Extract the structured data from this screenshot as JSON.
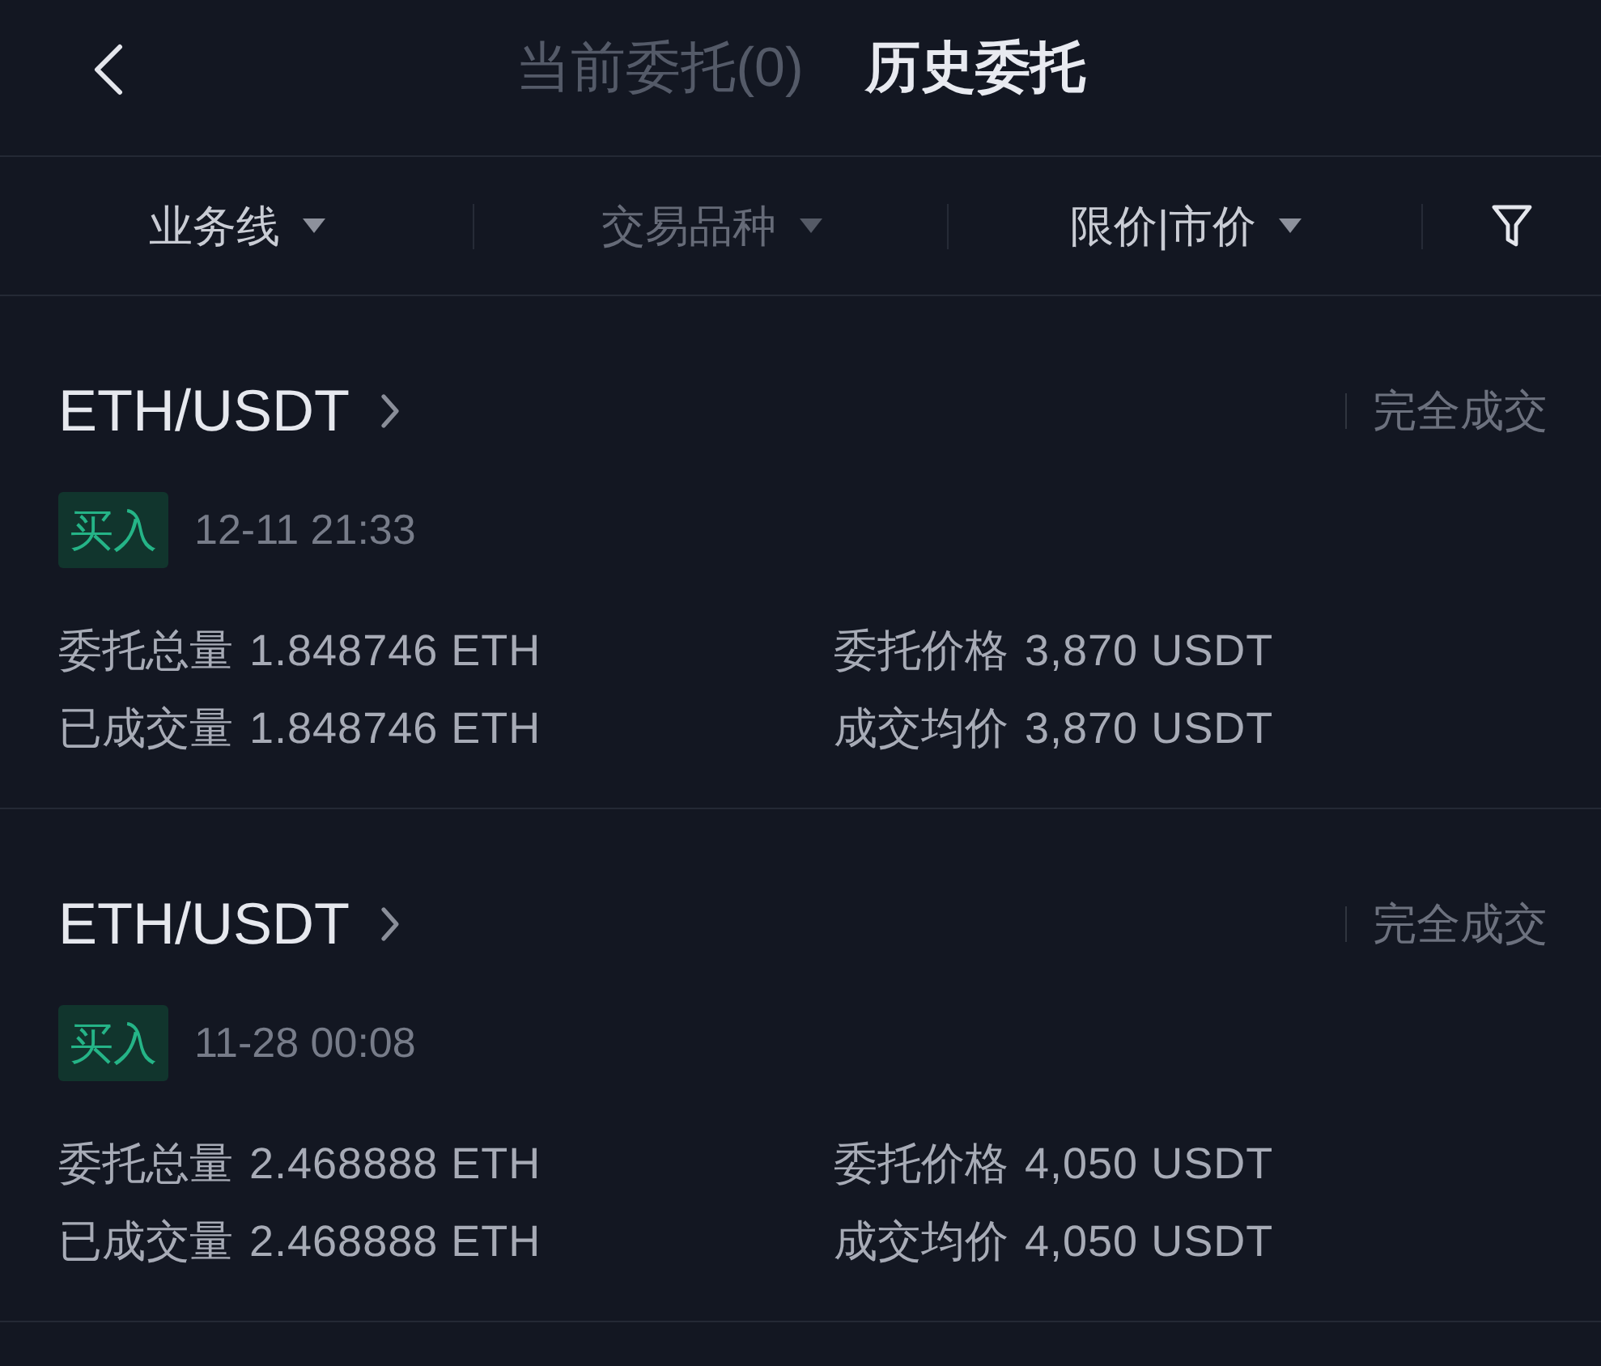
{
  "header": {
    "tabs": [
      {
        "label": "当前委托(0)",
        "selected": false
      },
      {
        "label": "历史委托",
        "selected": true
      }
    ]
  },
  "filters": [
    {
      "label": "业务线",
      "disabled": false
    },
    {
      "label": "交易品种",
      "disabled": true
    },
    {
      "label": "限价|市价",
      "disabled": false
    }
  ],
  "orders": [
    {
      "pair": "ETH/USDT",
      "status": "完全成交",
      "side": {
        "label": "买入",
        "kind": "buy"
      },
      "time": "12-11 21:33",
      "fields": [
        {
          "label": "委托总量",
          "value": "1.848746 ETH"
        },
        {
          "label": "委托价格",
          "value": "3,870 USDT"
        },
        {
          "label": "已成交量",
          "value": "1.848746 ETH"
        },
        {
          "label": "成交均价",
          "value": "3,870 USDT"
        }
      ]
    },
    {
      "pair": "ETH/USDT",
      "status": "完全成交",
      "side": {
        "label": "买入",
        "kind": "buy"
      },
      "time": "11-28 00:08",
      "fields": [
        {
          "label": "委托总量",
          "value": "2.468888 ETH"
        },
        {
          "label": "委托价格",
          "value": "4,050 USDT"
        },
        {
          "label": "已成交量",
          "value": "2.468888 ETH"
        },
        {
          "label": "成交均价",
          "value": "4,050 USDT"
        }
      ]
    }
  ]
}
